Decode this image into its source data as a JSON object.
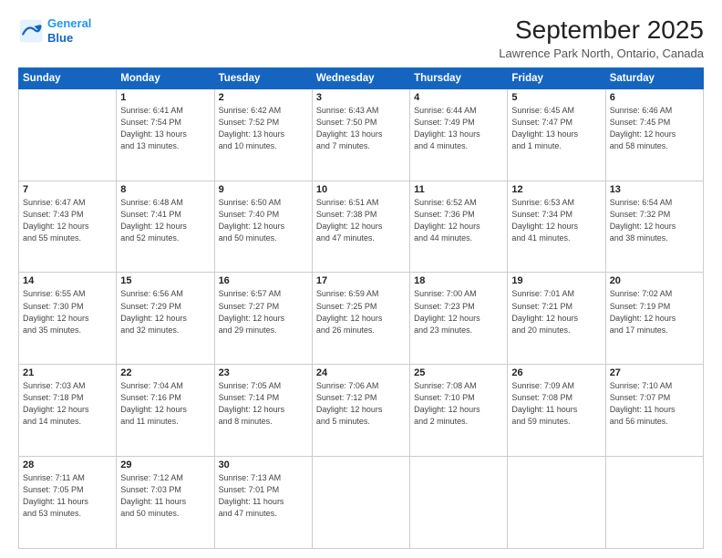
{
  "logo": {
    "line1": "General",
    "line2": "Blue"
  },
  "title": "September 2025",
  "location": "Lawrence Park North, Ontario, Canada",
  "days_header": [
    "Sunday",
    "Monday",
    "Tuesday",
    "Wednesday",
    "Thursday",
    "Friday",
    "Saturday"
  ],
  "weeks": [
    [
      {
        "day": "",
        "info": ""
      },
      {
        "day": "1",
        "info": "Sunrise: 6:41 AM\nSunset: 7:54 PM\nDaylight: 13 hours\nand 13 minutes."
      },
      {
        "day": "2",
        "info": "Sunrise: 6:42 AM\nSunset: 7:52 PM\nDaylight: 13 hours\nand 10 minutes."
      },
      {
        "day": "3",
        "info": "Sunrise: 6:43 AM\nSunset: 7:50 PM\nDaylight: 13 hours\nand 7 minutes."
      },
      {
        "day": "4",
        "info": "Sunrise: 6:44 AM\nSunset: 7:49 PM\nDaylight: 13 hours\nand 4 minutes."
      },
      {
        "day": "5",
        "info": "Sunrise: 6:45 AM\nSunset: 7:47 PM\nDaylight: 13 hours\nand 1 minute."
      },
      {
        "day": "6",
        "info": "Sunrise: 6:46 AM\nSunset: 7:45 PM\nDaylight: 12 hours\nand 58 minutes."
      }
    ],
    [
      {
        "day": "7",
        "info": "Sunrise: 6:47 AM\nSunset: 7:43 PM\nDaylight: 12 hours\nand 55 minutes."
      },
      {
        "day": "8",
        "info": "Sunrise: 6:48 AM\nSunset: 7:41 PM\nDaylight: 12 hours\nand 52 minutes."
      },
      {
        "day": "9",
        "info": "Sunrise: 6:50 AM\nSunset: 7:40 PM\nDaylight: 12 hours\nand 50 minutes."
      },
      {
        "day": "10",
        "info": "Sunrise: 6:51 AM\nSunset: 7:38 PM\nDaylight: 12 hours\nand 47 minutes."
      },
      {
        "day": "11",
        "info": "Sunrise: 6:52 AM\nSunset: 7:36 PM\nDaylight: 12 hours\nand 44 minutes."
      },
      {
        "day": "12",
        "info": "Sunrise: 6:53 AM\nSunset: 7:34 PM\nDaylight: 12 hours\nand 41 minutes."
      },
      {
        "day": "13",
        "info": "Sunrise: 6:54 AM\nSunset: 7:32 PM\nDaylight: 12 hours\nand 38 minutes."
      }
    ],
    [
      {
        "day": "14",
        "info": "Sunrise: 6:55 AM\nSunset: 7:30 PM\nDaylight: 12 hours\nand 35 minutes."
      },
      {
        "day": "15",
        "info": "Sunrise: 6:56 AM\nSunset: 7:29 PM\nDaylight: 12 hours\nand 32 minutes."
      },
      {
        "day": "16",
        "info": "Sunrise: 6:57 AM\nSunset: 7:27 PM\nDaylight: 12 hours\nand 29 minutes."
      },
      {
        "day": "17",
        "info": "Sunrise: 6:59 AM\nSunset: 7:25 PM\nDaylight: 12 hours\nand 26 minutes."
      },
      {
        "day": "18",
        "info": "Sunrise: 7:00 AM\nSunset: 7:23 PM\nDaylight: 12 hours\nand 23 minutes."
      },
      {
        "day": "19",
        "info": "Sunrise: 7:01 AM\nSunset: 7:21 PM\nDaylight: 12 hours\nand 20 minutes."
      },
      {
        "day": "20",
        "info": "Sunrise: 7:02 AM\nSunset: 7:19 PM\nDaylight: 12 hours\nand 17 minutes."
      }
    ],
    [
      {
        "day": "21",
        "info": "Sunrise: 7:03 AM\nSunset: 7:18 PM\nDaylight: 12 hours\nand 14 minutes."
      },
      {
        "day": "22",
        "info": "Sunrise: 7:04 AM\nSunset: 7:16 PM\nDaylight: 12 hours\nand 11 minutes."
      },
      {
        "day": "23",
        "info": "Sunrise: 7:05 AM\nSunset: 7:14 PM\nDaylight: 12 hours\nand 8 minutes."
      },
      {
        "day": "24",
        "info": "Sunrise: 7:06 AM\nSunset: 7:12 PM\nDaylight: 12 hours\nand 5 minutes."
      },
      {
        "day": "25",
        "info": "Sunrise: 7:08 AM\nSunset: 7:10 PM\nDaylight: 12 hours\nand 2 minutes."
      },
      {
        "day": "26",
        "info": "Sunrise: 7:09 AM\nSunset: 7:08 PM\nDaylight: 11 hours\nand 59 minutes."
      },
      {
        "day": "27",
        "info": "Sunrise: 7:10 AM\nSunset: 7:07 PM\nDaylight: 11 hours\nand 56 minutes."
      }
    ],
    [
      {
        "day": "28",
        "info": "Sunrise: 7:11 AM\nSunset: 7:05 PM\nDaylight: 11 hours\nand 53 minutes."
      },
      {
        "day": "29",
        "info": "Sunrise: 7:12 AM\nSunset: 7:03 PM\nDaylight: 11 hours\nand 50 minutes."
      },
      {
        "day": "30",
        "info": "Sunrise: 7:13 AM\nSunset: 7:01 PM\nDaylight: 11 hours\nand 47 minutes."
      },
      {
        "day": "",
        "info": ""
      },
      {
        "day": "",
        "info": ""
      },
      {
        "day": "",
        "info": ""
      },
      {
        "day": "",
        "info": ""
      }
    ]
  ]
}
